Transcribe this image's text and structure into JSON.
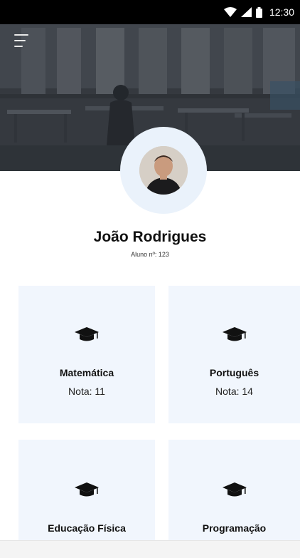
{
  "status_bar": {
    "time": "12:30",
    "icons": [
      "wifi-icon",
      "signal-icon",
      "battery-icon"
    ]
  },
  "header": {
    "menu_icon": "hamburger-menu-icon",
    "background": "classroom-photo"
  },
  "profile": {
    "name": "João Rodrigues",
    "student_id": "Aluno nº: 123"
  },
  "subjects": [
    {
      "name": "Matemática",
      "grade": "Nota: 11",
      "icon": "graduation-cap-icon"
    },
    {
      "name": "Português",
      "grade": "Nota: 14",
      "icon": "graduation-cap-icon"
    },
    {
      "name": "Educação Física",
      "grade": "",
      "icon": "graduation-cap-icon"
    },
    {
      "name": "Programação",
      "grade": "",
      "icon": "graduation-cap-icon"
    }
  ],
  "colors": {
    "card_background": "#f1f6fd",
    "avatar_ring": "#eaf2fb",
    "status_bar": "#000000"
  }
}
